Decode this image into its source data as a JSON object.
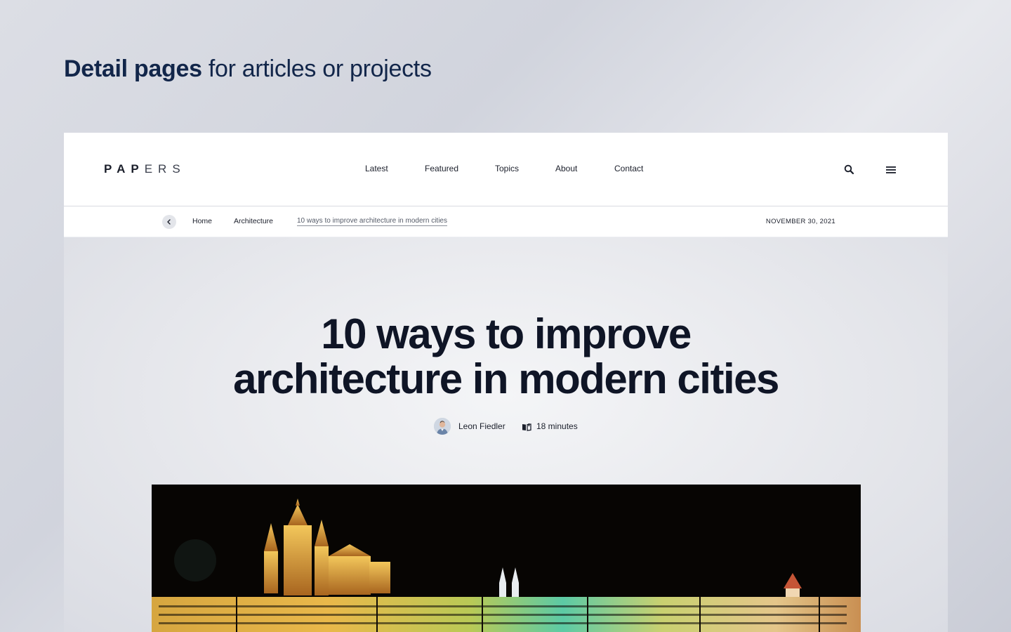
{
  "showcase": {
    "heading_bold": "Detail pages",
    "heading_rest": "for articles or projects"
  },
  "header": {
    "logo_strong": "PAP",
    "logo_light": "ERS",
    "nav": [
      "Latest",
      "Featured",
      "Topics",
      "About",
      "Contact"
    ],
    "search_icon": "search-icon",
    "menu_icon": "hamburger-menu-icon"
  },
  "breadcrumb": {
    "back_icon": "chevron-left-icon",
    "items": [
      "Home",
      "Architecture",
      "10 ways to improve architecture in modern cities"
    ],
    "date": "NOVEMBER 30, 2021"
  },
  "article": {
    "title_line1": "10 ways to improve",
    "title_line2": "architecture in modern cities",
    "author": "Leon Fiedler",
    "read_time": "18 minutes",
    "read_icon": "book-icon",
    "image": "night-city-castle-photo"
  },
  "colors": {
    "heading": "#12264a",
    "text": "#1b1f2b",
    "title": "#0f1526",
    "card_bg": "#ffffff",
    "photo_bg": "#070503"
  }
}
